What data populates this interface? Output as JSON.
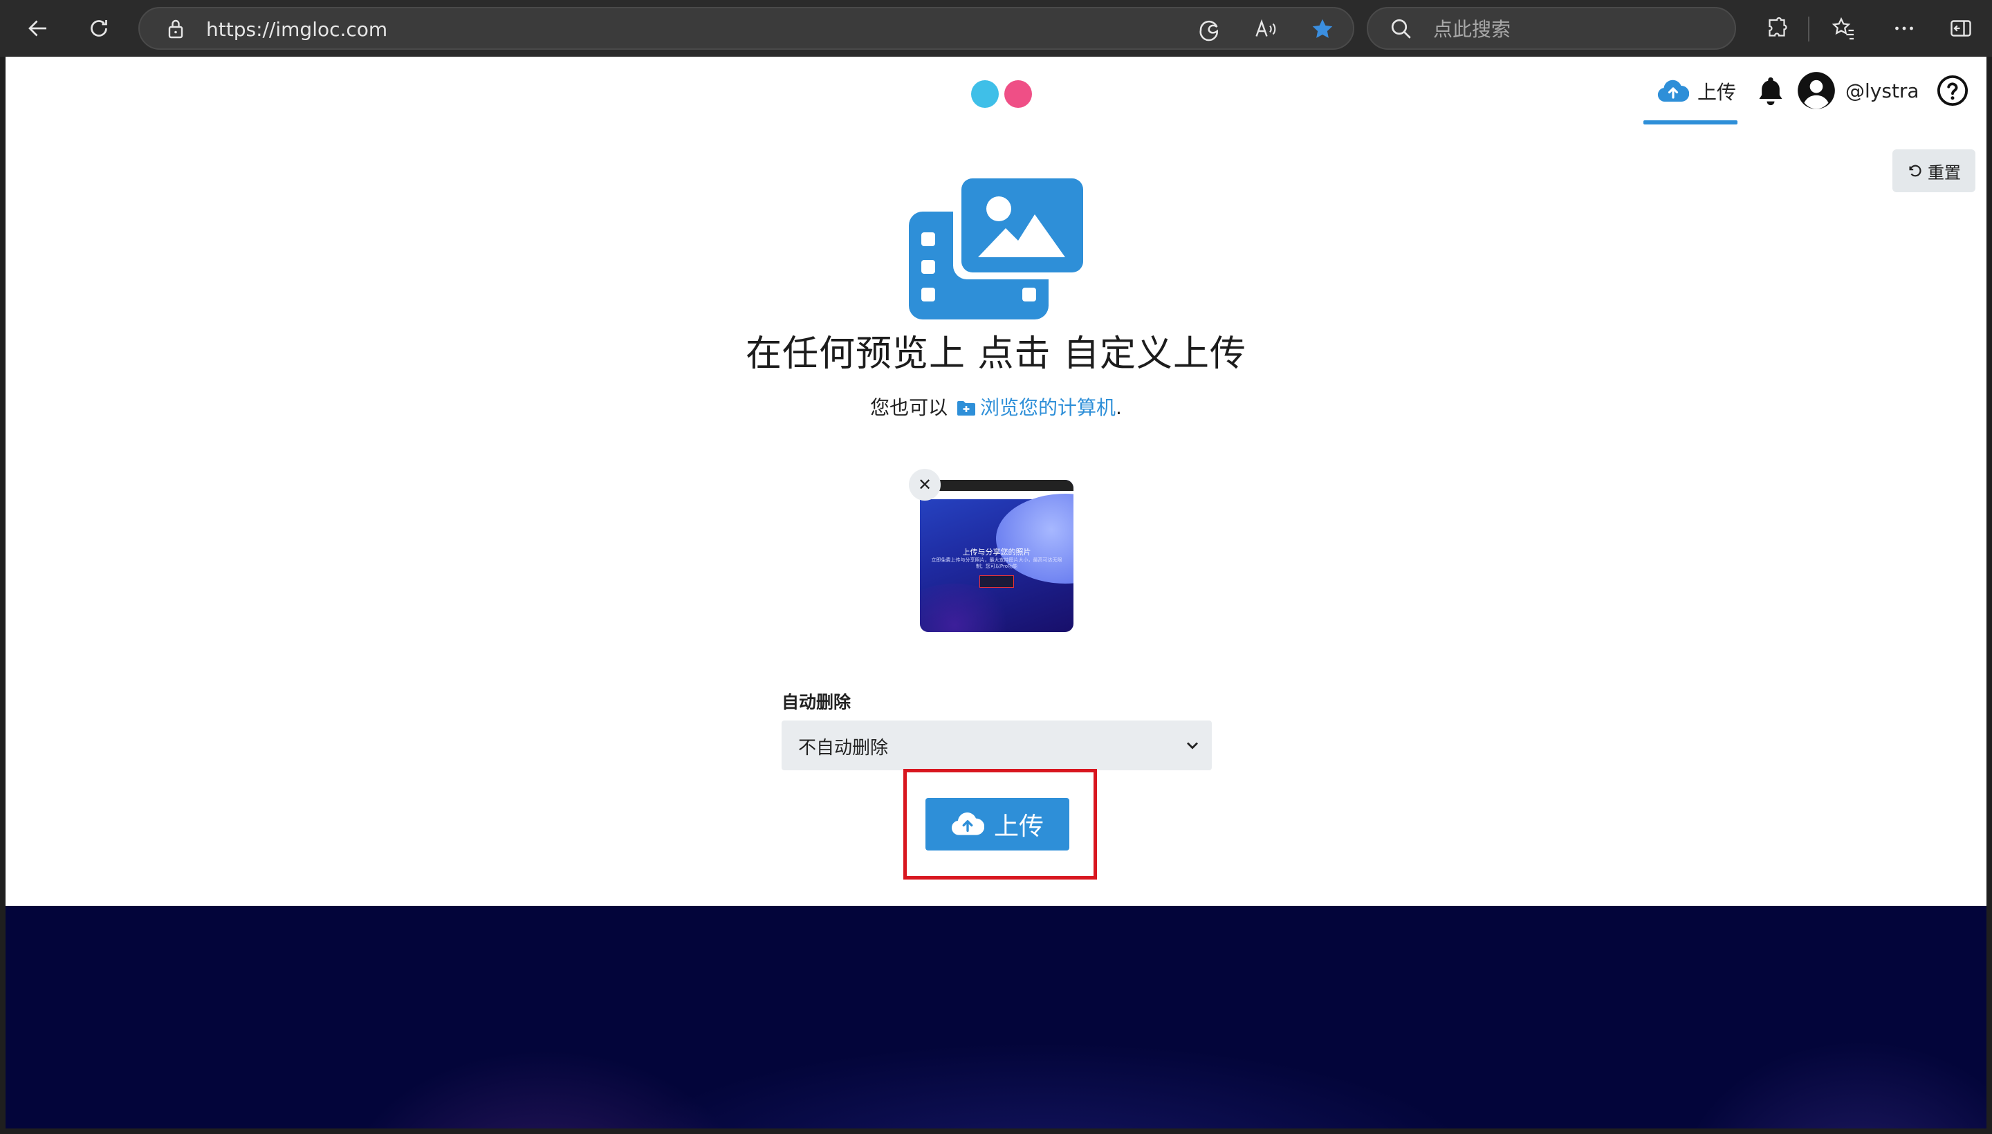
{
  "browser": {
    "url": "https://imgloc.com",
    "search_placeholder": "点此搜索"
  },
  "nav": {
    "upload_label": "上传",
    "username": "@lystra"
  },
  "toolbar": {
    "reset_label": "重置"
  },
  "main": {
    "headline": "在任何预览上 点击 自定义上传",
    "sub_prefix": "您也可以",
    "browse_link": "浏览您的计算机",
    "sub_suffix": "."
  },
  "preview": {
    "close_label": "✕",
    "inner_title": "上传与分享您的照片",
    "inner_text": "立即免费上传与分享照片，最大支持图片大小，最高可达无限制；您可以Pro功能"
  },
  "form": {
    "auto_delete_label": "自动删除",
    "auto_delete_value": "不自动删除"
  },
  "upload_button": {
    "label": "上传"
  },
  "colors": {
    "accent": "#2e8fd8",
    "logo_blue": "#3fbfe8",
    "logo_pink": "#ef4f86",
    "highlight": "#d8161f",
    "footer": "#03053a"
  }
}
